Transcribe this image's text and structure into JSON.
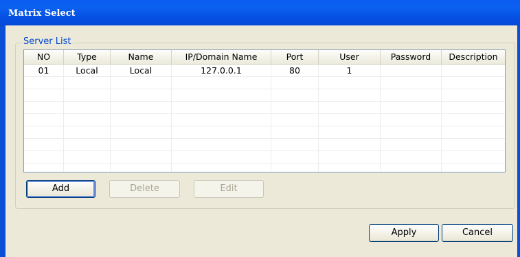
{
  "window": {
    "title": "Matrix Select"
  },
  "server_list": {
    "label": "Server List",
    "columns": [
      "NO",
      "Type",
      "Name",
      "IP/Domain Name",
      "Port",
      "User",
      "Password",
      "Description"
    ],
    "rows": [
      [
        "01",
        "Local",
        "Local",
        "127.0.0.1",
        "80",
        "1",
        "",
        ""
      ]
    ]
  },
  "buttons": {
    "add": "Add",
    "delete": "Delete",
    "edit": "Edit",
    "apply": "Apply",
    "cancel": "Cancel"
  },
  "colors": {
    "titlebar": "#0a5cf0",
    "group_label": "#0046d5",
    "dialog_bg": "#ece9d8"
  }
}
